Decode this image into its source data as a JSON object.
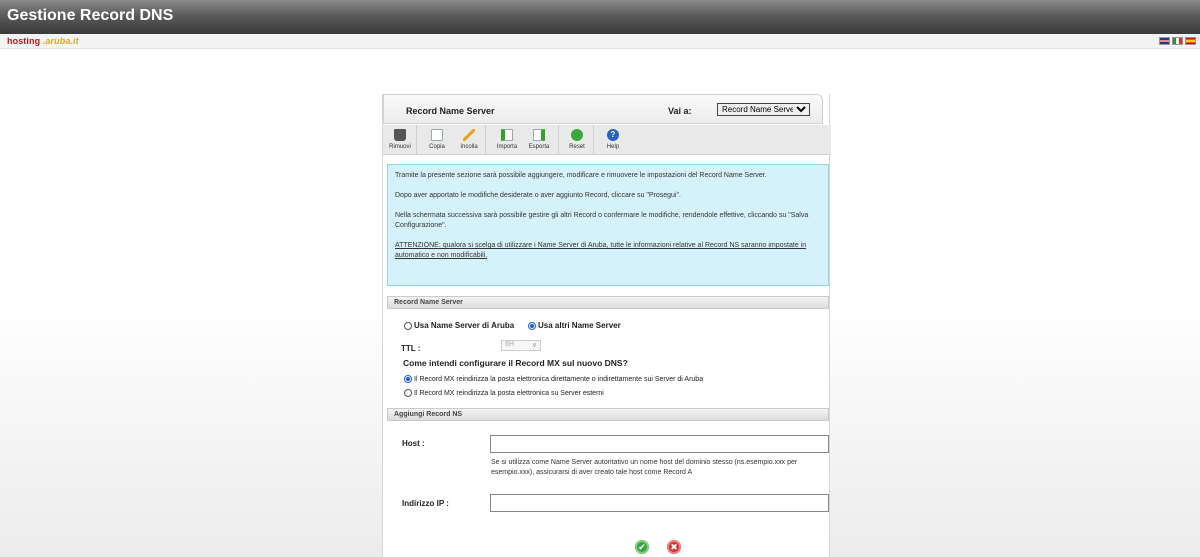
{
  "app": {
    "title": "Gestione Record DNS",
    "logo_prefix": "hosting",
    "logo_brand": ".aruba.it",
    "languages": [
      "uk-flag-icon",
      "it-flag-icon",
      "es-flag-icon"
    ]
  },
  "panel": {
    "title": "Record Name Server",
    "goto_label": "Vai a:",
    "goto_selected": "Record Name Server"
  },
  "toolbar": {
    "remove": "Rimuovi",
    "copy": "Copia",
    "paste": "Incolla",
    "import": "Importa",
    "export": "Esporta",
    "reset": "Reset",
    "help": "Help",
    "help_glyph": "?"
  },
  "info": {
    "p1": "Tramite la presente sezione sarà possibile aggiungere, modificare e rimuovere le impostazioni del Record Name Server.",
    "p2": "Dopo aver apportato le modifiche desiderate o aver aggiunto Record, cliccare su \"Prosegui\".",
    "p3": "Nella schermata successiva sarà possibile gestire gli altri Record o confermare le modifiche, rendendole effettive, cliccando su \"Salva Configurazione\".",
    "warning": "ATTENZIONE: qualora si scelga di utilizzare i Name Server di Aruba, tutte le informazioni relative al Record NS saranno impostate in automatico e non modificabili."
  },
  "ns_section": {
    "header": "Record Name Server",
    "option_aruba": "Usa Name Server di Aruba",
    "option_other": "Usa altri Name Server",
    "selected": "other",
    "ttl_label": "TTL :",
    "ttl_value": "6H",
    "mx_question": "Come intendi configurare il Record MX sul nuovo DNS?",
    "mx_option_aruba": "Il Record MX reindirizza la posta elettronica direttamente o indirettamente sui Server di Aruba",
    "mx_option_external": "Il Record MX reindirizza la posta elettronica su Server esterni",
    "mx_selected": "aruba"
  },
  "add_section": {
    "header": "Aggiungi Record NS",
    "host_label": "Host :",
    "host_value": "",
    "host_hint": "Se si utilizza come Name Server autoritativo un nome host del dominio stesso (ns.esempio.xxx per esempio.xxx), assicurarsi di aver creato tale host come Record A",
    "ip_label": "Indirizzo IP :",
    "ip_value": ""
  },
  "actions": {
    "confirm_glyph": "✔",
    "cancel_glyph": "✖"
  },
  "colors": {
    "info_bg": "#d5f2fb",
    "info_border": "#8fd3ea",
    "confirm": "#3ba640",
    "cancel": "#d92c2c"
  }
}
